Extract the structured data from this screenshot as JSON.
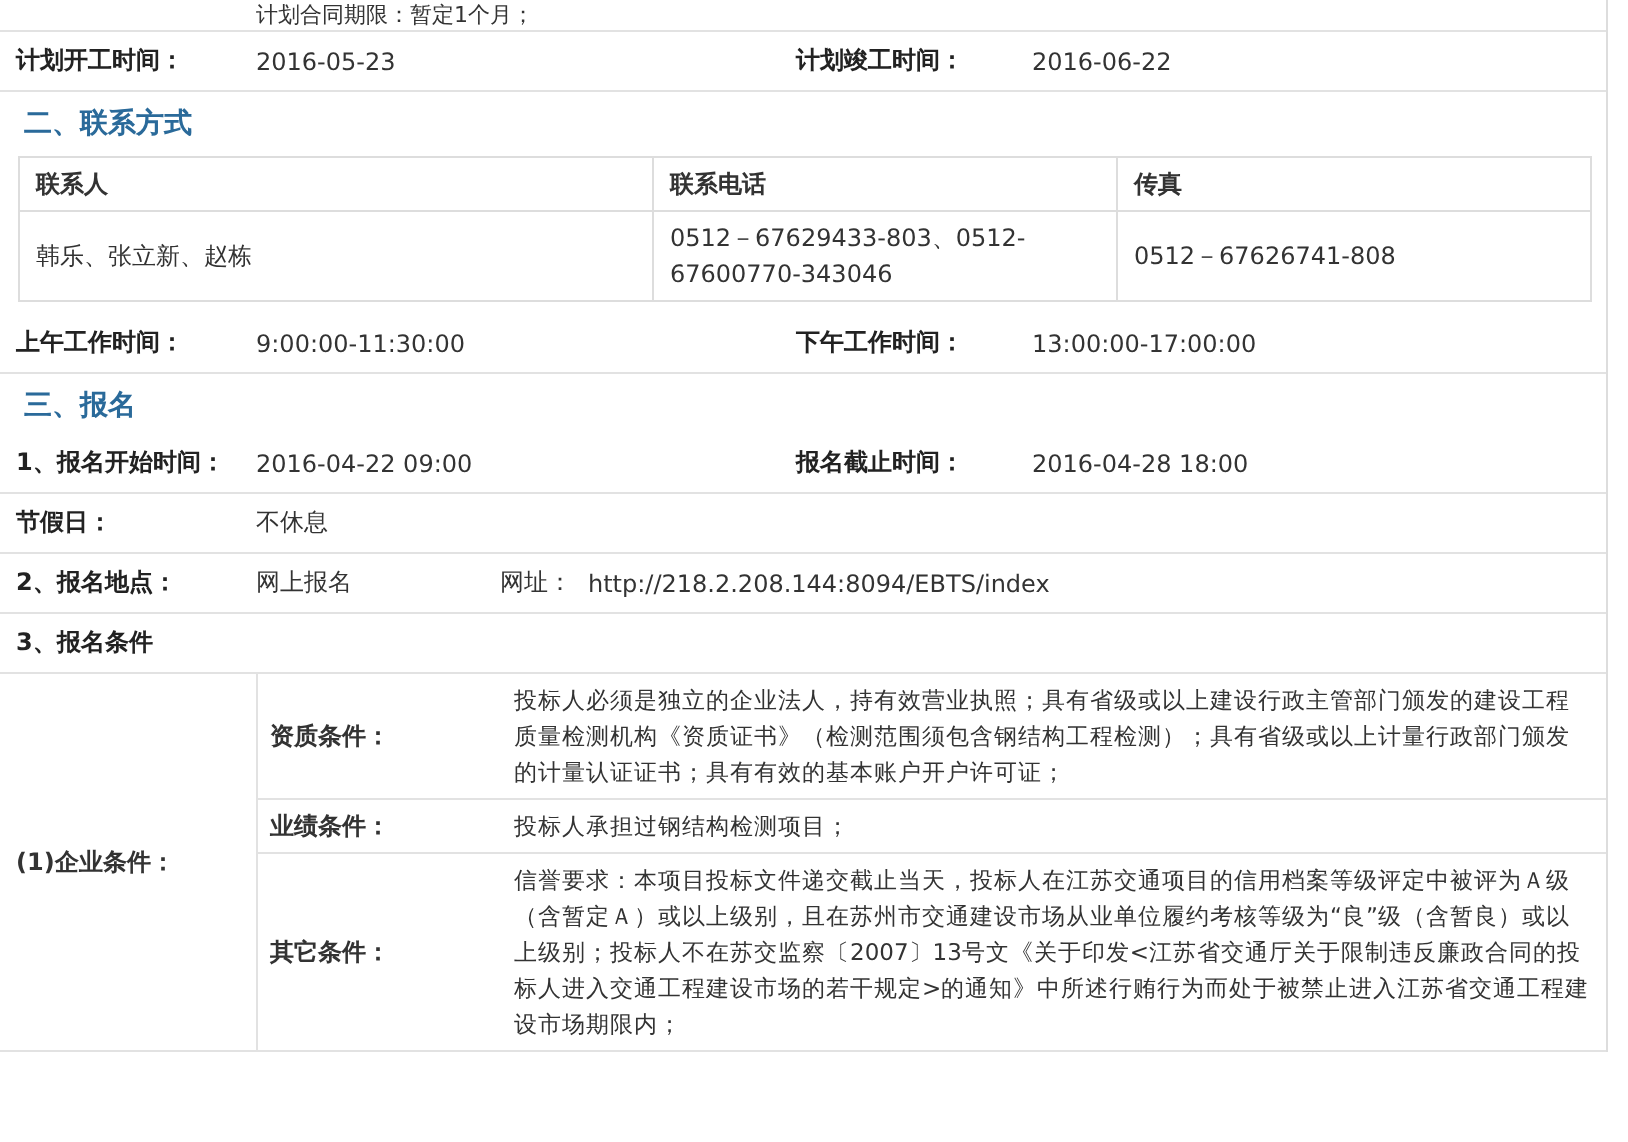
{
  "blocks": [
    {
      "kind": "note",
      "text": "计划合同期限：暂定1个月；"
    },
    {
      "kind": "pair",
      "label": "计划开工时间：",
      "value": "2016-05-23",
      "label_2": "计划竣工时间：",
      "value_2": "2016-06-22"
    },
    {
      "kind": "heading",
      "text": "二、联系方式"
    },
    {
      "kind": "table",
      "columns": [
        "联系人",
        "联系电话",
        "传真"
      ],
      "rows": [
        [
          "韩乐、张立新、赵栋",
          "0512－67629433-803、0512-67600770-343046",
          "0512－67626741-808"
        ]
      ]
    },
    {
      "kind": "pair",
      "label": "上午工作时间：",
      "value": "9:00:00-11:30:00",
      "label_2": "下午工作时间：",
      "value_2": "13:00:00-17:00:00"
    },
    {
      "kind": "heading",
      "text": "三、报名"
    },
    {
      "kind": "pair",
      "label": "1、报名开始时间：",
      "value": "2016-04-22 09:00",
      "label_2": "报名截止时间：",
      "value_2": "2016-04-28 18:00"
    },
    {
      "kind": "single",
      "label": "节假日：",
      "value": "不休息"
    },
    {
      "kind": "site",
      "label": "2、报名地点：",
      "value": "网上报名",
      "url_label": "网址：",
      "url": "http://218.2.208.144:8094/EBTS/index"
    },
    {
      "kind": "subheading",
      "text": "3、报名条件"
    },
    {
      "kind": "conditions",
      "label": "(1)企业条件：",
      "items": [
        {
          "label": "资质条件：",
          "text": "投标人必须是独立的企业法人，持有效营业执照；具有省级或以上建设行政主管部门颁发的建设工程质量检测机构《资质证书》（检测范围须包含钢结构工程检测）；具有省级或以上计量行政部门颁发的计量认证证书；具有有效的基本账户开户许可证；"
        },
        {
          "label": "业绩条件：",
          "text": "投标人承担过钢结构检测项目；"
        },
        {
          "label": "其它条件：",
          "text": "信誉要求：本项目投标文件递交截止当天，投标人在江苏交通项目的信用档案等级评定中被评为Ａ级（含暂定Ａ）或以上级别，且在苏州市交通建设市场从业单位履约考核等级为“良”级（含暂良）或以上级别；投标人不在苏交监察〔2007〕13号文《关于印发<江苏省交通厅关于限制违反廉政合同的投标人进入交通工程建设市场的若干规定>的通知》中所述行贿行为而处于被禁止进入江苏省交通工程建设市场期限内；"
        }
      ]
    }
  ]
}
